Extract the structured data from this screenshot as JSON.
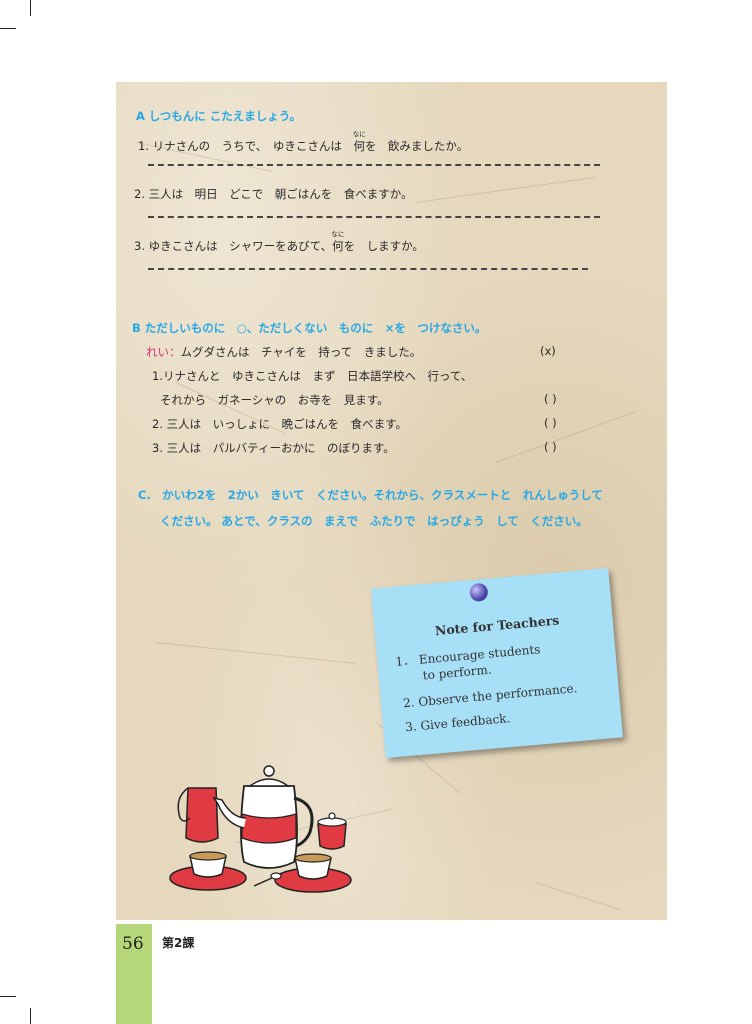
{
  "section_a": {
    "title": "A しつもんに こたえましょう。",
    "questions": [
      {
        "num": "1.",
        "pre": "リナさんの　うちで、　ゆきこさんは　",
        "ruby_base": "何",
        "ruby_text": "なに",
        "post": "を　飲みましたか。"
      },
      {
        "num": "2.",
        "pre": "三人は　明日　どこで　朝ごはんを　食べますか。",
        "ruby_base": "",
        "ruby_text": "",
        "post": ""
      },
      {
        "num": "3.",
        "pre": "ゆきこさんは　シャワーをあびて、",
        "ruby_base": "何",
        "ruby_text": "なに",
        "post": "を　しますか。"
      }
    ]
  },
  "section_b": {
    "title": "B ただしいものに　○、ただしくない　ものに　×を　つけなさい。",
    "example_label": "れい：",
    "example_text": "ムグダさんは　チャイを　持って　きました。",
    "example_answer": "(x)",
    "items": [
      {
        "num": "1.",
        "line1": "リナさんと　ゆきこさんは　まず　日本語学校へ　行って、",
        "line2": "それから　ガネーシャの　お寺を　見ます。",
        "answer": "(   )"
      },
      {
        "num": "2.",
        "line1": "三人は　いっしょに　晩ごはんを　食べます。",
        "line2": "",
        "answer": "(   )"
      },
      {
        "num": "3.",
        "line1": "三人は　パルバティーおかに　のぼります。",
        "line2": "",
        "answer": "(   )"
      }
    ]
  },
  "section_c": {
    "line1": "C.　かいわ2を　2かい　きいて　ください。それから、クラスメートと　れんしゅうして",
    "line2": "ください。 あとで、クラスの　まえで　ふたりで　はっぴょう　して　ください。"
  },
  "note": {
    "title": "Note for Teachers",
    "items": [
      {
        "num": "1．",
        "text1": "Encourage students",
        "text2": "to perform."
      },
      {
        "num": "2.",
        "text1": "Observe the performance.",
        "text2": ""
      },
      {
        "num": "3.",
        "text1": "Give feedback.",
        "text2": ""
      }
    ]
  },
  "footer": {
    "page_number": "56",
    "lesson": "第2課"
  },
  "colors": {
    "heading_blue": "#27a8e6",
    "example_label": "#e0306f",
    "tab_green": "#b5d77a",
    "note_blue": "#a7dff7"
  }
}
